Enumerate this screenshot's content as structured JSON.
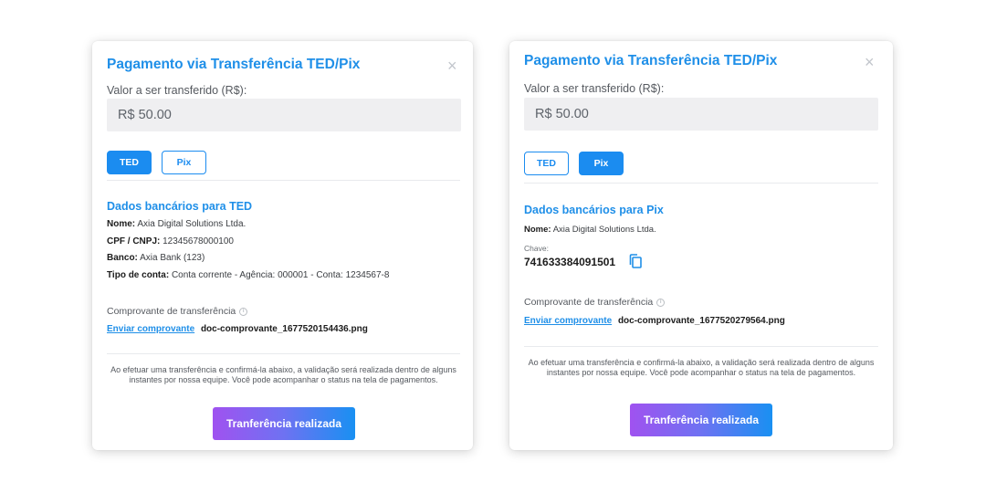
{
  "modal_ted": {
    "title": "Pagamento via Transferência TED/Pix",
    "close_symbol": "×",
    "amount_label": "Valor a ser transferido (R$):",
    "amount_value": "R$ 50.00",
    "tabs": [
      {
        "label": "TED",
        "active": true
      },
      {
        "label": "Pix",
        "active": false
      }
    ],
    "section_title": "Dados bancários para TED",
    "fields": [
      {
        "label": "Nome:",
        "value": "Axia Digital Solutions Ltda."
      },
      {
        "label": "CPF / CNPJ:",
        "value": "12345678000100"
      },
      {
        "label": "Banco:",
        "value": "Axia Bank (123)"
      },
      {
        "label": "Tipo de conta:",
        "value": "Conta corrente - Agência: 000001 - Conta: 1234567-8"
      }
    ],
    "receipt_label": "Comprovante de transferência",
    "receipt_link": "Enviar comprovante",
    "receipt_filename": "doc-comprovante_1677520154436.png",
    "notice": "Ao efetuar uma transferência e confirmá-la abaixo, a validação será realizada dentro de alguns instantes por nossa equipe. Você pode acompanhar o status na tela de pagamentos.",
    "cta_label": "Tranferência realizada"
  },
  "modal_pix": {
    "title": "Pagamento via Transferência TED/Pix",
    "close_symbol": "×",
    "amount_label": "Valor a ser transferido (R$):",
    "amount_value": "R$ 50.00",
    "tabs": [
      {
        "label": "TED",
        "active": false
      },
      {
        "label": "Pix",
        "active": true
      }
    ],
    "section_title": "Dados bancários para Pix",
    "fields": [
      {
        "label": "Nome:",
        "value": "Axia Digital Solutions Ltda."
      }
    ],
    "key_label": "Chave:",
    "key_value": "741633384091501",
    "copy_icon": "copy-icon",
    "receipt_label": "Comprovante de transferência",
    "receipt_link": "Enviar comprovante",
    "receipt_filename": "doc-comprovante_1677520279564.png",
    "notice": "Ao efetuar uma transferência e confirmá-la abaixo, a validação será realizada dentro de alguns instantes por nossa equipe. Você pode acompanhar o status na tela de pagamentos.",
    "cta_label": "Tranferência realizada"
  },
  "colors": {
    "accent": "#1f8fe8",
    "tab_active_bg": "#1b8cf0",
    "cta_gradient_start": "#a052f0",
    "cta_gradient_end": "#1990f2",
    "input_bg": "#efeff1"
  },
  "icons": {
    "close": "close-icon",
    "info": "info-icon",
    "copy": "copy-icon"
  }
}
